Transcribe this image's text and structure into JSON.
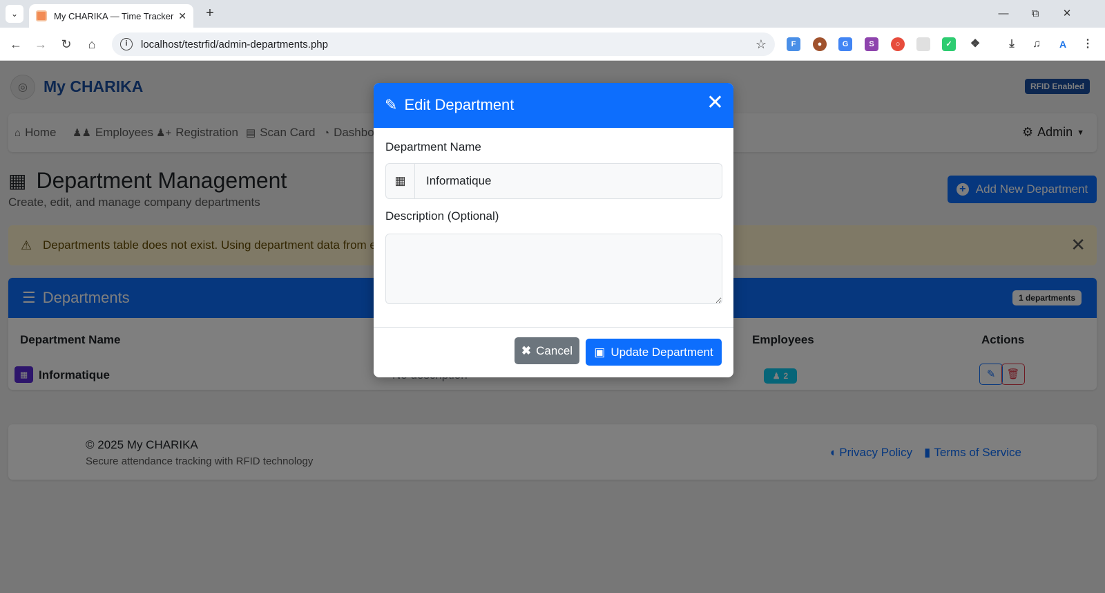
{
  "browser": {
    "tab_title": "My CHARIKA — Time Tracker",
    "url": "localhost/testrfid/admin-departments.php"
  },
  "header": {
    "brand": "My CHARIKA",
    "rfid_badge": "RFID Enabled"
  },
  "nav": {
    "items": [
      {
        "label": "Home",
        "icon": "home-icon"
      },
      {
        "label": "Employees",
        "icon": "users-icon"
      },
      {
        "label": "Registration",
        "icon": "user-plus-icon"
      },
      {
        "label": "Scan Card",
        "icon": "id-card-icon"
      },
      {
        "label": "Dashbo",
        "icon": "dashboard-icon"
      }
    ],
    "admin_label": "Admin"
  },
  "main": {
    "title": "Department Management",
    "subtitle": "Create, edit, and manage company departments",
    "add_button": "Add New Department"
  },
  "alert": {
    "text": "Departments table does not exist. Using department data from en"
  },
  "table": {
    "title": "Departments",
    "count_badge": "1 departments",
    "headers": [
      "Department Name",
      "Employees",
      "Actions"
    ],
    "rows": [
      {
        "name": "Informatique",
        "description": "No description",
        "employees": "2"
      }
    ]
  },
  "footer": {
    "copyright": "© 2025 My CHARIKA",
    "tagline": "Secure attendance tracking with RFID technology",
    "privacy": "Privacy Policy",
    "terms": "Terms of Service"
  },
  "modal": {
    "title": "Edit Department",
    "name_label": "Department Name",
    "name_value": "Informatique",
    "description_label": "Description (Optional)",
    "description_value": "",
    "cancel_label": "Cancel",
    "update_label": "Update Department"
  },
  "colors": {
    "primary": "#0d6efd",
    "brand": "#1b4fa0",
    "secondary": "#6c757d",
    "danger": "#dc3545",
    "info": "#0dcaf0",
    "warning_bg": "#fff3cd"
  }
}
